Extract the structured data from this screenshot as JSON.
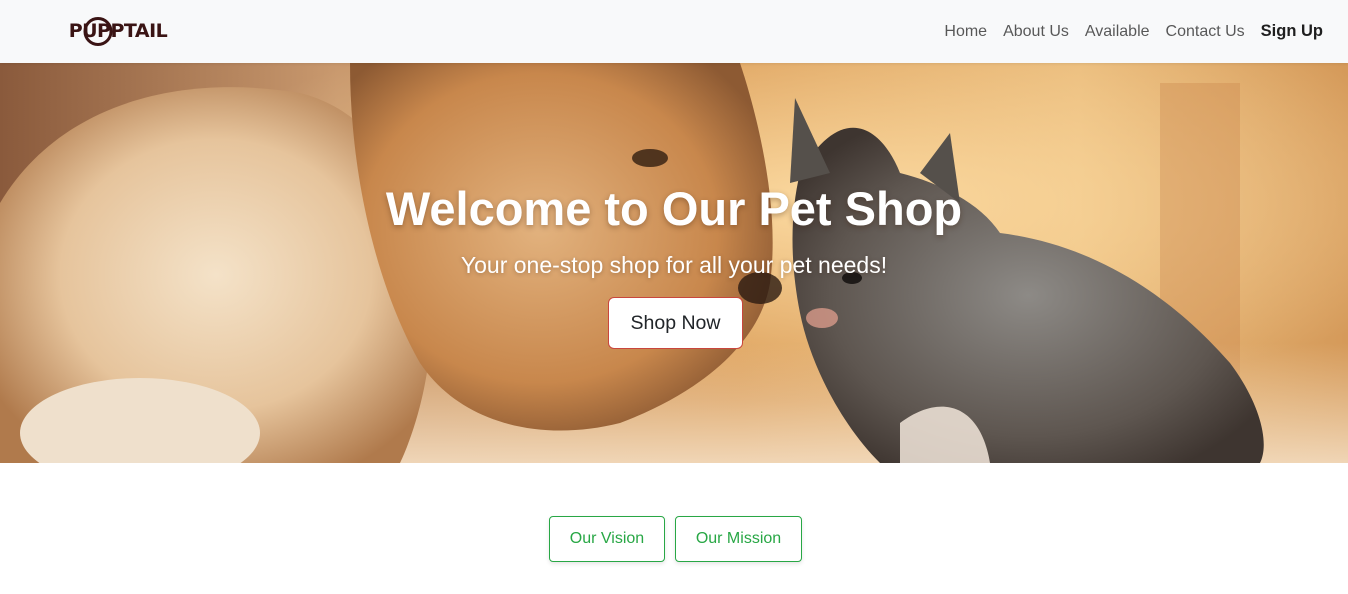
{
  "navbar": {
    "brand_text": "PUPPTAIL",
    "links": [
      "Home",
      "About Us",
      "Available",
      "Contact Us"
    ],
    "signup_label": "Sign Up"
  },
  "hero": {
    "title": "Welcome to Our Pet Shop",
    "subtitle": "Your one-stop shop for all your pet needs!",
    "cta_label": "Shop Now",
    "image": "puppy-and-kitten-photo"
  },
  "tabs": {
    "vision_label": "Our Vision",
    "mission_label": "Our Mission"
  },
  "colors": {
    "navbar_bg": "#f8f9fa",
    "tab_accent": "#28a745",
    "cta_border": "#c9463d"
  }
}
